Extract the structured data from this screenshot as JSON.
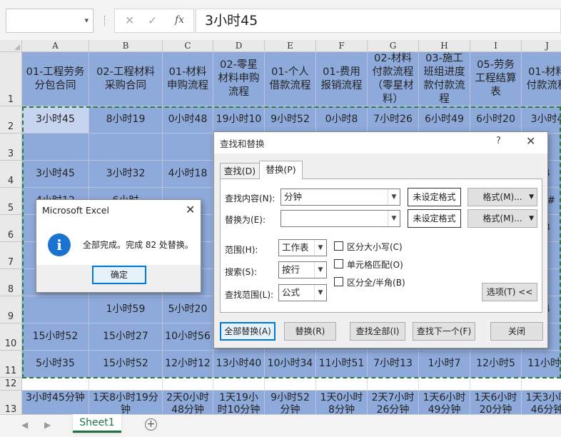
{
  "formula_bar": {
    "name_box": "",
    "cancel_glyph": "✕",
    "enter_glyph": "✓",
    "fx_label": "fx",
    "formula_value": "3小时45"
  },
  "columns": [
    "A",
    "B",
    "C",
    "D",
    "E",
    "F",
    "G",
    "H",
    "I",
    "J"
  ],
  "rows": [
    "1",
    "2",
    "3",
    "4",
    "5",
    "6",
    "7",
    "8",
    "9",
    "10",
    "11",
    "12",
    "13"
  ],
  "header_row": [
    "01-工程劳务\n分包合同",
    "02-工程材料\n采购合同",
    "01-材料\n申购流程",
    "02-零星\n材料申购\n流程",
    "01-个人\n借款流程",
    "01-费用\n报销流程",
    "02-材料\n付款流程\n（零星材\n料）",
    "03-施工\n班组进度\n款付款流\n程",
    "05-劳务\n工程结算\n表",
    "01-材料\n付款流程"
  ],
  "data_rows": [
    [
      "3小时45",
      "8小时19",
      "0小时48",
      "19小时10",
      "9小时52",
      "0小时8",
      "7小时26",
      "6小时49",
      "6小时20",
      "3小时4"
    ],
    [
      "",
      "",
      "",
      "",
      "",
      "",
      "",
      "",
      "",
      ""
    ],
    [
      "3小时45",
      "3小时32",
      "4小时18",
      "",
      "",
      "",
      "",
      "",
      "",
      "4"
    ],
    [
      "4小时12",
      "6小时",
      "",
      "",
      "",
      "",
      "",
      "",
      "",
      "##"
    ],
    [
      "1",
      "",
      "",
      "",
      "",
      "",
      "",
      "",
      "",
      "3"
    ],
    [
      "",
      "",
      "",
      "",
      "",
      "",
      "",
      "",
      "",
      ""
    ],
    [
      "",
      "",
      "",
      "",
      "",
      "",
      "",
      "",
      "",
      ""
    ],
    [
      "",
      "1小时59",
      "5小时20",
      "",
      "",
      "",
      "",
      "",
      "",
      "4"
    ],
    [
      "15小时52",
      "15小时27",
      "10小时56",
      "",
      "",
      "",
      "",
      "",
      "",
      ""
    ],
    [
      "5小时35",
      "15小时52",
      "12小时12",
      "13小时40",
      "10小时34",
      "11小时51",
      "7小时13",
      "1小时7",
      "12小时5",
      "11小时5"
    ],
    [
      "",
      "",
      "",
      "",
      "",
      "",
      "",
      "",
      "",
      ""
    ],
    [
      "3小时45分钟",
      "1天8小时19分\n钟",
      "2天0小时\n48分钟",
      "1天19小\n时10分钟",
      "9小时52\n分钟",
      "1天0小时\n8分钟",
      "2天7小时\n26分钟",
      "1天6小时\n49分钟",
      "1天6小时\n20分钟",
      "1天3小时\n46分钟"
    ]
  ],
  "sheet_tabs": {
    "nav_prev": "◀",
    "nav_next": "▶",
    "active_sheet": "Sheet1",
    "add_sheet": "+"
  },
  "find_replace": {
    "title": "查找和替换",
    "help_glyph": "?",
    "close_glyph": "✕",
    "tab_find": "查找(D)",
    "tab_replace": "替换(P)",
    "find_what_label": "查找内容(N):",
    "find_what_value": "分钟",
    "replace_with_label": "替换为(E):",
    "replace_with_value": "",
    "no_format_1": "未设定格式",
    "no_format_2": "未设定格式",
    "format_button_1": "格式(M)...",
    "format_button_2": "格式(M)...",
    "within_label": "范围(H):",
    "within_value": "工作表",
    "search_label": "搜索(S):",
    "search_value": "按行",
    "look_in_label": "查找范围(L):",
    "look_in_value": "公式",
    "match_case_label": "区分大小写(C)",
    "match_entire_label": "单元格匹配(O)",
    "match_width_label": "区分全/半角(B)",
    "match_case_checked": false,
    "match_entire_checked": false,
    "match_width_checked": false,
    "options_button": "选项(T) <<",
    "replace_all_button": "全部替换(A)",
    "replace_button": "替换(R)",
    "find_all_button": "查找全部(I)",
    "find_next_button": "查找下一个(F)",
    "close_button": "关闭"
  },
  "message_box": {
    "title": "Microsoft Excel",
    "close_glyph": "✕",
    "icon": "info-icon",
    "icon_glyph": "i",
    "message": "全部完成。完成 82 处替换。",
    "ok_button": "确定"
  },
  "colors": {
    "cell_blue": "#8eaadb",
    "active_cell": "#c6d4ef",
    "selection_border": "#2a7a43",
    "excel_green": "#217346",
    "dialog_accent": "#0078d7",
    "info_icon": "#1a73d1"
  }
}
